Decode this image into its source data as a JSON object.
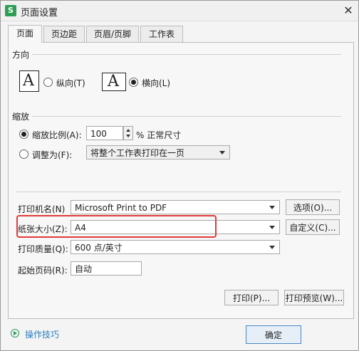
{
  "window": {
    "app_icon_letter": "S",
    "title": "页面设置",
    "close_glyph": "✕"
  },
  "tabs": [
    {
      "label": "页面"
    },
    {
      "label": "页边距"
    },
    {
      "label": "页眉/页脚"
    },
    {
      "label": "工作表"
    }
  ],
  "orientation": {
    "group_label": "方向",
    "picture_letter": "A",
    "portrait_label": "纵向(T)",
    "landscape_label": "横向(L)",
    "selected": "landscape"
  },
  "scaling": {
    "group_label": "缩放",
    "scale_label": "缩放比例(A):",
    "scale_value": "100",
    "scale_suffix": "% 正常尺寸",
    "fit_label": "调整为(F):",
    "fit_option": "将整个工作表打印在一页",
    "selected": "scale"
  },
  "print": {
    "printer_label": "打印机名(N)",
    "printer_value": "Microsoft Print to PDF",
    "options_button": "选项(O)...",
    "paper_label": "纸张大小(Z):",
    "paper_value": "A4",
    "custom_button": "自定义(C)...",
    "quality_label": "打印质量(Q):",
    "quality_value": "600 点/英寸",
    "first_page_label": "起始页码(R):",
    "first_page_value": "自动"
  },
  "buttons": {
    "print": "打印(P)...",
    "preview": "打印预览(W)...",
    "ok": "确定"
  },
  "tips": {
    "label": "操作技巧"
  },
  "colors": {
    "highlight": "#e03b3b",
    "app_icon": "#2e9e57",
    "link": "#2a7fc0"
  }
}
